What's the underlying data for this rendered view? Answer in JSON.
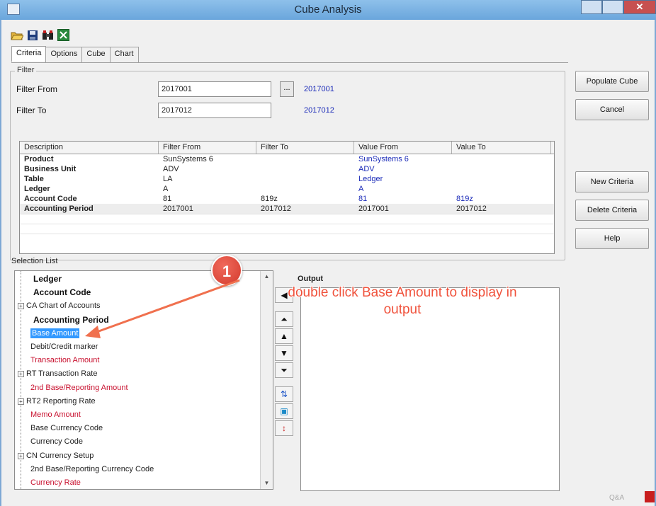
{
  "window": {
    "title": "Cube Analysis"
  },
  "tabs": [
    {
      "label": "Criteria",
      "active": true
    },
    {
      "label": "Options",
      "active": false
    },
    {
      "label": "Cube",
      "active": false
    },
    {
      "label": "Chart",
      "active": false
    }
  ],
  "filter": {
    "group_label": "Filter",
    "from_label": "Filter From",
    "to_label": "Filter To",
    "from_value": "2017001",
    "to_value": "2017012",
    "from_display": "2017001",
    "to_display": "2017012",
    "browse_label": "..."
  },
  "criteria_table": {
    "columns": [
      "Description",
      "Filter From",
      "Filter To",
      "Value From",
      "Value To"
    ],
    "rows": [
      [
        "Product",
        "SunSystems 6",
        "",
        "SunSystems 6",
        ""
      ],
      [
        "Business Unit",
        "ADV",
        "",
        "ADV",
        ""
      ],
      [
        "Table",
        "LA",
        "",
        "Ledger",
        ""
      ],
      [
        "Ledger",
        "A",
        "",
        "A",
        ""
      ],
      [
        "Account Code",
        "81",
        "819z",
        "81",
        "819z"
      ],
      [
        "Accounting Period",
        "2017001",
        "2017012",
        "2017001",
        "2017012"
      ]
    ]
  },
  "side_buttons": {
    "populate": "Populate Cube",
    "cancel": "Cancel",
    "new_criteria": "New Criteria",
    "delete_criteria": "Delete Criteria",
    "help": "Help"
  },
  "selection": {
    "label": "Selection List",
    "items": [
      {
        "text": "Ledger",
        "style": "bold",
        "expand": false
      },
      {
        "text": "Account Code",
        "style": "bold",
        "expand": false
      },
      {
        "text": "CA  Chart of Accounts",
        "style": "normal",
        "expand": true
      },
      {
        "text": "Accounting Period",
        "style": "bold",
        "expand": false
      },
      {
        "text": "Base Amount",
        "style": "selected",
        "expand": false
      },
      {
        "text": "Debit/Credit marker",
        "style": "normal",
        "expand": false
      },
      {
        "text": "Transaction Amount",
        "style": "red",
        "expand": false
      },
      {
        "text": "RT  Transaction Rate",
        "style": "normal",
        "expand": true
      },
      {
        "text": "2nd Base/Reporting Amount",
        "style": "red",
        "expand": false
      },
      {
        "text": "RT2  Reporting Rate",
        "style": "normal",
        "expand": true
      },
      {
        "text": "Memo Amount",
        "style": "red",
        "expand": false
      },
      {
        "text": "Base Currency Code",
        "style": "normal",
        "expand": false
      },
      {
        "text": "Currency Code",
        "style": "normal",
        "expand": false
      },
      {
        "text": "CN  Currency Setup",
        "style": "normal",
        "expand": true
      },
      {
        "text": "2nd Base/Reporting Currency Code",
        "style": "normal",
        "expand": false
      },
      {
        "text": "Currency Rate",
        "style": "red",
        "expand": false
      }
    ]
  },
  "output": {
    "label": "Output"
  },
  "annotation": {
    "number": "1",
    "text_line1": "double click Base Amount to display in",
    "text_line2": "output"
  },
  "watermark": "Q&A",
  "colors": {
    "accent_red": "#f0523c",
    "blue_text": "#1a2ab8",
    "selection": "#3399ff",
    "field_red": "#c8102e"
  }
}
